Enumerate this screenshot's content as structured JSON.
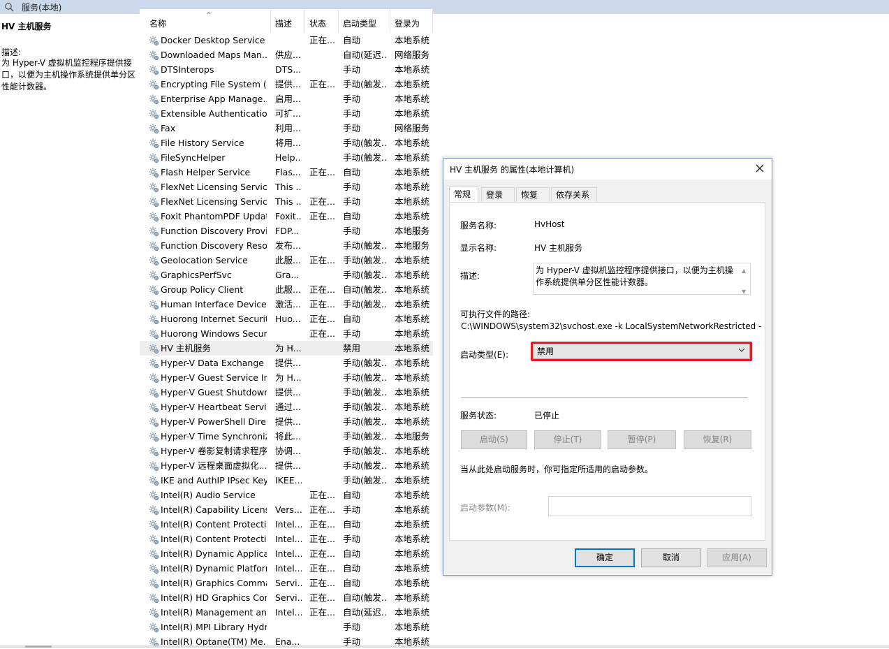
{
  "window": {
    "title": "服务(本地)"
  },
  "left_panel": {
    "service_title": "HV 主机服务",
    "desc_label": "描述:",
    "desc_text": "为 Hyper-V 虚拟机监控程序提供接口，以便为主机操作系统提供单分区性能计数器。"
  },
  "columns": {
    "name": "名称",
    "desc": "描述",
    "state": "状态",
    "startup": "启动类型",
    "logon": "登录为"
  },
  "services": [
    {
      "name": "Docker Desktop Service",
      "desc": "",
      "state": "正在...",
      "startup": "自动",
      "logon": "本地系统"
    },
    {
      "name": "Downloaded Maps Man...",
      "desc": "供应...",
      "state": "",
      "startup": "自动(延迟...",
      "logon": "网络服务"
    },
    {
      "name": "DTSInterops",
      "desc": "DTS...",
      "state": "",
      "startup": "手动",
      "logon": "本地系统"
    },
    {
      "name": "Encrypting File System (E...",
      "desc": "提供...",
      "state": "正在...",
      "startup": "手动(触发...",
      "logon": "本地系统"
    },
    {
      "name": "Enterprise App Manage...",
      "desc": "启用...",
      "state": "",
      "startup": "手动",
      "logon": "本地系统"
    },
    {
      "name": "Extensible Authentication...",
      "desc": "可扩...",
      "state": "",
      "startup": "手动",
      "logon": "本地系统"
    },
    {
      "name": "Fax",
      "desc": "利用...",
      "state": "",
      "startup": "手动",
      "logon": "网络服务"
    },
    {
      "name": "File History Service",
      "desc": "将用...",
      "state": "",
      "startup": "手动(触发...",
      "logon": "本地系统"
    },
    {
      "name": "FileSyncHelper",
      "desc": "Help...",
      "state": "",
      "startup": "手动(触发...",
      "logon": "本地系统"
    },
    {
      "name": "Flash Helper Service",
      "desc": "Flas...",
      "state": "正在...",
      "startup": "自动",
      "logon": "本地系统"
    },
    {
      "name": "FlexNet Licensing Service",
      "desc": "This ...",
      "state": "",
      "startup": "手动",
      "logon": "本地系统"
    },
    {
      "name": "FlexNet Licensing Service...",
      "desc": "This ...",
      "state": "正在...",
      "startup": "手动",
      "logon": "本地系统"
    },
    {
      "name": "Foxit PhantomPDF Updat...",
      "desc": "Foxit...",
      "state": "正在...",
      "startup": "自动",
      "logon": "本地系统"
    },
    {
      "name": "Function Discovery Provi...",
      "desc": "FDP...",
      "state": "",
      "startup": "手动",
      "logon": "本地服务"
    },
    {
      "name": "Function Discovery Reso...",
      "desc": "发布...",
      "state": "",
      "startup": "手动(触发...",
      "logon": "本地服务"
    },
    {
      "name": "Geolocation Service",
      "desc": "此服...",
      "state": "正在...",
      "startup": "手动(触发...",
      "logon": "本地系统"
    },
    {
      "name": "GraphicsPerfSvc",
      "desc": "Gra...",
      "state": "",
      "startup": "手动(触发...",
      "logon": "本地系统"
    },
    {
      "name": "Group Policy Client",
      "desc": "此服...",
      "state": "正在...",
      "startup": "自动(触发...",
      "logon": "本地系统"
    },
    {
      "name": "Human Interface Device ...",
      "desc": "激活...",
      "state": "正在...",
      "startup": "手动(触发...",
      "logon": "本地系统"
    },
    {
      "name": "Huorong Internet Securit...",
      "desc": "Huo...",
      "state": "正在...",
      "startup": "自动",
      "logon": "本地系统"
    },
    {
      "name": "Huorong Windows Secur...",
      "desc": "",
      "state": "正在...",
      "startup": "手动",
      "logon": "本地系统"
    },
    {
      "name": "HV 主机服务",
      "desc": "为 H...",
      "state": "",
      "startup": "禁用",
      "logon": "本地系统",
      "selected": true
    },
    {
      "name": "Hyper-V Data Exchange ...",
      "desc": "提供...",
      "state": "",
      "startup": "手动(触发...",
      "logon": "本地系统"
    },
    {
      "name": "Hyper-V Guest Service In...",
      "desc": "为 H...",
      "state": "",
      "startup": "手动(触发...",
      "logon": "本地系统"
    },
    {
      "name": "Hyper-V Guest Shutdown...",
      "desc": "提供...",
      "state": "",
      "startup": "手动(触发...",
      "logon": "本地系统"
    },
    {
      "name": "Hyper-V Heartbeat Service",
      "desc": "通过...",
      "state": "",
      "startup": "手动(触发...",
      "logon": "本地系统"
    },
    {
      "name": "Hyper-V PowerShell Dire...",
      "desc": "提供...",
      "state": "",
      "startup": "手动(触发...",
      "logon": "本地系统"
    },
    {
      "name": "Hyper-V Time Synchroniz...",
      "desc": "将此...",
      "state": "",
      "startup": "手动(触发...",
      "logon": "本地服务"
    },
    {
      "name": "Hyper-V 卷影复制请求程序",
      "desc": "协调...",
      "state": "",
      "startup": "手动(触发...",
      "logon": "本地系统"
    },
    {
      "name": "Hyper-V 远程桌面虚拟化...",
      "desc": "提供...",
      "state": "",
      "startup": "手动(触发...",
      "logon": "本地系统"
    },
    {
      "name": "IKE and AuthIP IPsec Key...",
      "desc": "IKEE...",
      "state": "",
      "startup": "手动(触发...",
      "logon": "本地系统"
    },
    {
      "name": "Intel(R) Audio Service",
      "desc": "",
      "state": "正在...",
      "startup": "自动",
      "logon": "本地系统"
    },
    {
      "name": "Intel(R) Capability Licensi...",
      "desc": "Vers...",
      "state": "正在...",
      "startup": "手动",
      "logon": "本地系统"
    },
    {
      "name": "Intel(R) Content Protectio...",
      "desc": "Intel...",
      "state": "正在...",
      "startup": "自动",
      "logon": "本地系统"
    },
    {
      "name": "Intel(R) Content Protectio...",
      "desc": "Intel...",
      "state": "正在...",
      "startup": "手动",
      "logon": "本地系统"
    },
    {
      "name": "Intel(R) Dynamic Applicat...",
      "desc": "Intel...",
      "state": "正在...",
      "startup": "自动",
      "logon": "本地系统"
    },
    {
      "name": "Intel(R) Dynamic Platform...",
      "desc": "Intel...",
      "state": "正在...",
      "startup": "自动",
      "logon": "本地系统"
    },
    {
      "name": "Intel(R) Graphics Comma...",
      "desc": "Servi...",
      "state": "正在...",
      "startup": "自动",
      "logon": "本地系统"
    },
    {
      "name": "Intel(R) HD Graphics Con...",
      "desc": "Servi...",
      "state": "正在...",
      "startup": "自动(触发...",
      "logon": "本地系统"
    },
    {
      "name": "Intel(R) Management an...",
      "desc": "Intel...",
      "state": "正在...",
      "startup": "自动(延迟...",
      "logon": "本地系统"
    },
    {
      "name": "Intel(R) MPI Library Hydr...",
      "desc": "",
      "state": "",
      "startup": "手动",
      "logon": "本地系统"
    },
    {
      "name": "Intel(R) Optane(TM) Me...",
      "desc": "Ena...",
      "state": "",
      "startup": "手动",
      "logon": "本地系统"
    }
  ],
  "dialog": {
    "title": "HV 主机服务 的属性(本地计算机)",
    "tabs": [
      "常规",
      "登录",
      "恢复",
      "依存关系"
    ],
    "service_name_label": "服务名称:",
    "service_name": "HvHost",
    "display_name_label": "显示名称:",
    "display_name": "HV 主机服务",
    "description_label": "描述:",
    "description": "为 Hyper-V 虚拟机监控程序提供接口，以便为主机操作系统提供单分区性能计数器。",
    "exe_path_label": "可执行文件的路径:",
    "exe_path": "C:\\WINDOWS\\system32\\svchost.exe -k LocalSystemNetworkRestricted -",
    "startup_type_label": "启动类型(E):",
    "startup_type_value": "禁用",
    "service_status_label": "服务状态:",
    "service_status": "已停止",
    "btn_start": "启动(S)",
    "btn_stop": "停止(T)",
    "btn_pause": "暂停(P)",
    "btn_resume": "恢复(R)",
    "hint": "当从此处启动服务时，你可指定所适用的启动参数。",
    "start_params_label": "启动参数(M):",
    "start_params_value": "",
    "btn_ok": "确定",
    "btn_cancel": "取消",
    "btn_apply": "应用(A)"
  },
  "colors": {
    "highlight_outline": "#e01b24",
    "default_button": "#0078d7",
    "topbar": "#ccd9ea"
  }
}
